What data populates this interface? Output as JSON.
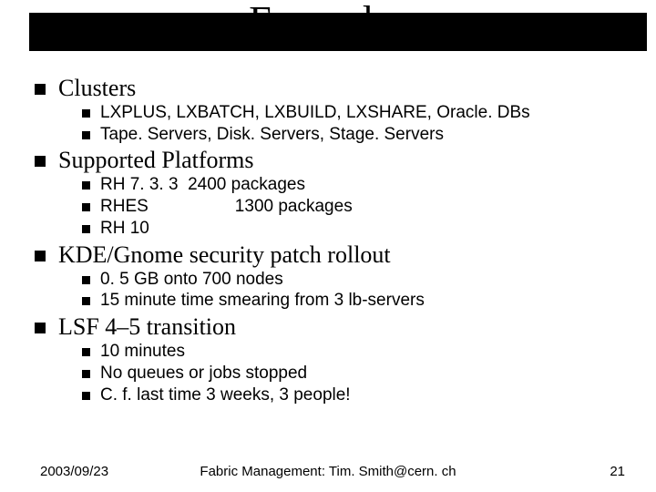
{
  "title": "Examples",
  "sections": [
    {
      "heading": "Clusters",
      "items": [
        "LXPLUS, LXBATCH, LXBUILD, LXSHARE, Oracle. DBs",
        "Tape. Servers, Disk. Servers, Stage. Servers"
      ]
    },
    {
      "heading": "Supported Platforms",
      "items": [
        "RH 7. 3. 3  2400 packages",
        "RHES                  1300 packages",
        "RH 10"
      ]
    },
    {
      "heading": "KDE/Gnome security patch rollout",
      "items": [
        "0. 5 GB onto 700 nodes",
        "15 minute time smearing from 3 lb-servers"
      ]
    },
    {
      "heading": "LSF 4–5 transition",
      "items": [
        "10 minutes",
        "No queues or jobs stopped",
        "C. f. last time 3 weeks, 3 people!"
      ]
    }
  ],
  "footer": {
    "date": "2003/09/23",
    "center": "Fabric Management: Tim. Smith@cern. ch",
    "page": "21"
  }
}
